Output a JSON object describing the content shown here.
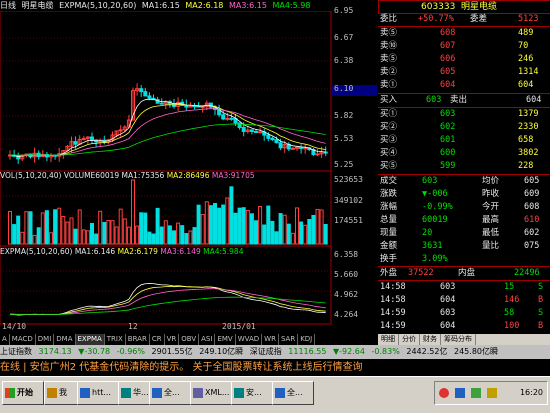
{
  "header": {
    "period": "日线",
    "name": "明星电缆",
    "ma_label": "EXPMA(5,10,20,60)",
    "ma1": "MA1:6.15",
    "ma2": "MA2:6.18",
    "ma3": "MA3:6.15",
    "ma4": "MA4:5.98"
  },
  "price_axis": [
    "6.95",
    "6.67",
    "6.38",
    "6.10",
    "5.82",
    "5.53",
    "5.25"
  ],
  "vol_header": {
    "label": "VOL(5,10,20,40)",
    "volume": "VOLUME60019",
    "ma1": "MA1:75356",
    "ma2": "MA2:86496",
    "ma3": "MA3:91705"
  },
  "vol_axis": [
    "523653",
    "349102",
    "174551"
  ],
  "expma_header": {
    "label": "EXPMA(5,10,20,60)",
    "ma1": "MA1:6.146",
    "ma2": "MA2:6.179",
    "ma3": "MA3:6.149",
    "ma4": "MA4:5.984"
  },
  "expma_axis": [
    "6.358",
    "5.660",
    "4.962",
    "4.264"
  ],
  "time_axis": [
    "14/10",
    "12",
    "2015/01"
  ],
  "quote": {
    "code": "603333",
    "name": "明星电缆",
    "webi_label": "委比",
    "webi": "+50.77%",
    "weicha_label": "委差",
    "weicha": "5123",
    "sell": [
      {
        "l": "卖⑤",
        "p": "608",
        "v": "489"
      },
      {
        "l": "卖⑩",
        "p": "607",
        "v": "70"
      },
      {
        "l": "卖⑤",
        "p": "606",
        "v": "246"
      },
      {
        "l": "卖②",
        "p": "605",
        "v": "1314"
      },
      {
        "l": "卖①",
        "p": "604",
        "v": "604"
      }
    ],
    "buy1_label": "买入",
    "buy1": "603",
    "sell1_label": "卖出",
    "sell1": "604",
    "buy": [
      {
        "l": "买①",
        "p": "603",
        "v": "1379"
      },
      {
        "l": "买②",
        "p": "602",
        "v": "2330"
      },
      {
        "l": "买③",
        "p": "601",
        "v": "658"
      },
      {
        "l": "买④",
        "p": "600",
        "v": "3802"
      },
      {
        "l": "买⑤",
        "p": "599",
        "v": "228"
      }
    ],
    "stats": [
      {
        "l1": "成交",
        "v1": "603",
        "l2": "均价",
        "v2": "605"
      },
      {
        "l1": "涨跌",
        "v1": "▼-006",
        "l2": "昨收",
        "v2": "609"
      },
      {
        "l1": "涨幅",
        "v1": "-0.99%",
        "l2": "今开",
        "v2": "608"
      },
      {
        "l1": "总量",
        "v1": "60019",
        "l2": "最高",
        "v2": "610"
      },
      {
        "l1": "现量",
        "v1": "20",
        "l2": "最低",
        "v2": "602"
      },
      {
        "l1": "金额",
        "v1": "3631",
        "l2": "量比",
        "v2": "075"
      },
      {
        "l1": "换手",
        "v1": "3.09%",
        "l2": "",
        "v2": ""
      }
    ],
    "outer_label": "外盘",
    "outer": "37522",
    "inner_label": "内盘",
    "inner": "22496",
    "ticks": [
      {
        "t": "14:58",
        "p": "603",
        "v": "15",
        "d": "S"
      },
      {
        "t": "14:58",
        "p": "604",
        "v": "146",
        "d": "B"
      },
      {
        "t": "14:59",
        "p": "603",
        "v": "58",
        "d": "S"
      },
      {
        "t": "14:59",
        "p": "604",
        "v": "100",
        "d": "B"
      },
      {
        "t": "14:59",
        "p": "603",
        "v": "20",
        "d": "S"
      }
    ]
  },
  "tabs": [
    "A",
    "MACD",
    "DMI",
    "DMA",
    "EXPMA",
    "TRIX",
    "BRAR",
    "CR",
    "VR",
    "OBV",
    "ASI",
    "EMV",
    "WVAD",
    "WR",
    "SAR",
    "KDJ"
  ],
  "right_tabs": [
    "明细",
    "分价",
    "财务",
    "筹码分布"
  ],
  "status": {
    "idx1_label": "上证指数",
    "idx1": "3174.13",
    "idx1_chg": "▼-30.78",
    "idx1_pct": "-0.96%",
    "idx1_amt": "2901.55亿",
    "idx1_amt2": "249.10亿瞬",
    "idx2_label": "深证成指",
    "idx2": "11116.55",
    "idx2_chg": "▼-92.64",
    "idx2_pct": "-0.83%",
    "idx2_amt": "2442.52亿",
    "idx2_amt2": "245.80亿瞬"
  },
  "ticker": "在线 | 安信广州2 代基金代码清除的提示。    关于全国股票转让系统上线后行情查询",
  "taskbar": {
    "start": "开始",
    "items": [
      "我",
      "htt...",
      "华...",
      "全...",
      "XML...",
      "安...",
      "全..."
    ],
    "clock": "16:20"
  }
}
